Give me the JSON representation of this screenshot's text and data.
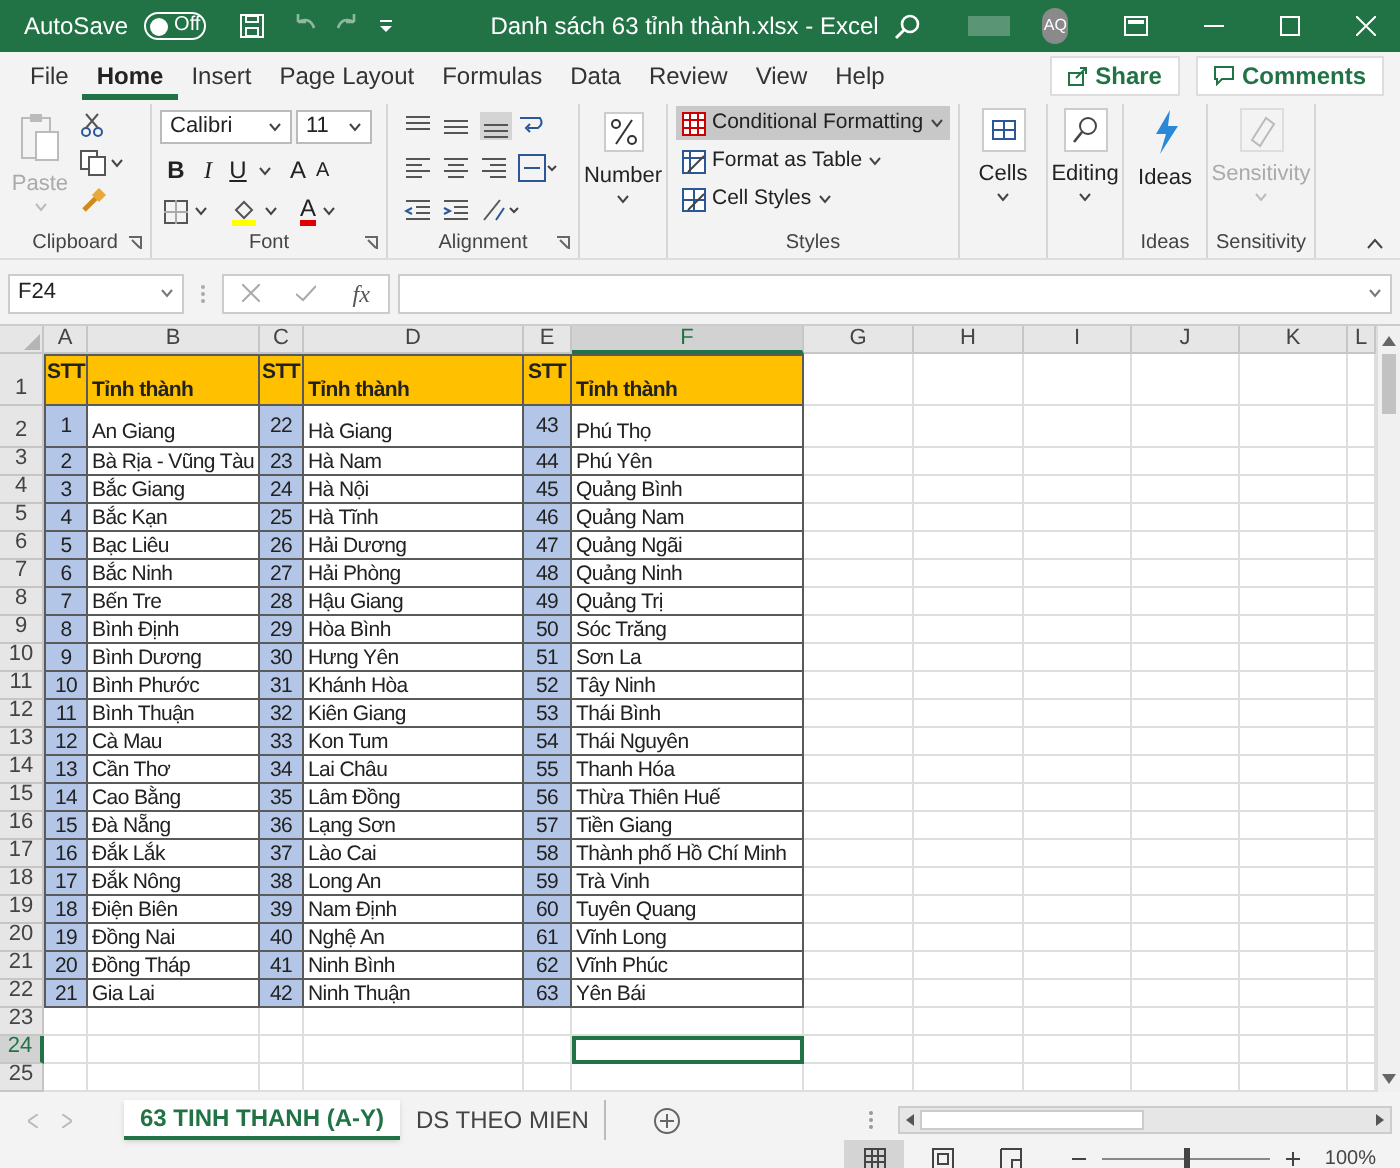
{
  "title_bar": {
    "autosave_label": "AutoSave",
    "autosave": {
      "on": false,
      "label": "Off"
    },
    "title": "Danh sách 63 tỉnh thành.xlsx - Excel",
    "avatar": "AQ"
  },
  "menu": {
    "tabs": [
      {
        "label": "File",
        "selected": false
      },
      {
        "label": "Home",
        "selected": true
      },
      {
        "label": "Insert",
        "selected": false
      },
      {
        "label": "Page Layout",
        "selected": false
      },
      {
        "label": "Formulas",
        "selected": false
      },
      {
        "label": "Data",
        "selected": false
      },
      {
        "label": "Review",
        "selected": false
      },
      {
        "label": "View",
        "selected": false
      },
      {
        "label": "Help",
        "selected": false
      }
    ],
    "share": "Share",
    "comments": "Comments"
  },
  "ribbon": {
    "clipboard": {
      "paste": {
        "label": "Paste",
        "disabled": true
      },
      "label": "Clipboard"
    },
    "font": {
      "family": "Calibri",
      "size": "11",
      "bold": "B",
      "italic": "I",
      "underline": "U",
      "grow": "A",
      "shrink": "A",
      "font_color": "A",
      "label": "Font"
    },
    "alignment": {
      "label": "Alignment"
    },
    "number": {
      "button": "Number"
    },
    "styles": {
      "items": [
        {
          "label": "Conditional Formatting",
          "selected": true
        },
        {
          "label": "Format as Table",
          "selected": false
        },
        {
          "label": "Cell Styles",
          "selected": false
        }
      ],
      "label": "Styles"
    },
    "cells": {
      "button": "Cells"
    },
    "editing": {
      "button": "Editing"
    },
    "ideas": {
      "button": "Ideas",
      "label": "Ideas"
    },
    "sensitivity": {
      "button": "Sensitivity",
      "disabled": true,
      "label": "Sensitivity"
    }
  },
  "formula_bar": {
    "name_box": "F24",
    "function_label": "fx"
  },
  "sheet": {
    "columns": [
      {
        "label": "A",
        "selected": false
      },
      {
        "label": "B",
        "selected": false
      },
      {
        "label": "C",
        "selected": false
      },
      {
        "label": "D",
        "selected": false
      },
      {
        "label": "E",
        "selected": false
      },
      {
        "label": "F",
        "selected": true
      },
      {
        "label": "G",
        "selected": false
      },
      {
        "label": "H",
        "selected": false
      },
      {
        "label": "I",
        "selected": false
      },
      {
        "label": "J",
        "selected": false
      },
      {
        "label": "K",
        "selected": false
      },
      {
        "label": "L",
        "selected": false
      }
    ],
    "row_headers": [
      {
        "label": "1",
        "selected": false
      },
      {
        "label": "2",
        "selected": false
      },
      {
        "label": "3",
        "selected": false
      },
      {
        "label": "4",
        "selected": false
      },
      {
        "label": "5",
        "selected": false
      },
      {
        "label": "6",
        "selected": false
      },
      {
        "label": "7",
        "selected": false
      },
      {
        "label": "8",
        "selected": false
      },
      {
        "label": "9",
        "selected": false
      },
      {
        "label": "10",
        "selected": false
      },
      {
        "label": "11",
        "selected": false
      },
      {
        "label": "12",
        "selected": false
      },
      {
        "label": "13",
        "selected": false
      },
      {
        "label": "14",
        "selected": false
      },
      {
        "label": "15",
        "selected": false
      },
      {
        "label": "16",
        "selected": false
      },
      {
        "label": "17",
        "selected": false
      },
      {
        "label": "18",
        "selected": false
      },
      {
        "label": "19",
        "selected": false
      },
      {
        "label": "20",
        "selected": false
      },
      {
        "label": "21",
        "selected": false
      },
      {
        "label": "22",
        "selected": false
      },
      {
        "label": "23",
        "selected": false
      },
      {
        "label": "24",
        "selected": true
      },
      {
        "label": "25",
        "selected": false
      }
    ],
    "header": [
      "STT",
      "Tỉnh thành",
      "STT",
      "Tỉnh thành",
      "STT",
      "Tỉnh thành"
    ],
    "rows": [
      [
        "1",
        "An Giang",
        "22",
        "Hà Giang",
        "43",
        "Phú Thọ"
      ],
      [
        "2",
        "Bà Rịa - Vũng Tàu",
        "23",
        "Hà Nam",
        "44",
        "Phú Yên"
      ],
      [
        "3",
        "Bắc Giang",
        "24",
        "Hà Nội",
        "45",
        "Quảng Bình"
      ],
      [
        "4",
        "Bắc Kạn",
        "25",
        "Hà Tĩnh",
        "46",
        "Quảng Nam"
      ],
      [
        "5",
        "Bạc Liêu",
        "26",
        "Hải Dương",
        "47",
        "Quảng Ngãi"
      ],
      [
        "6",
        "Bắc Ninh",
        "27",
        "Hải Phòng",
        "48",
        "Quảng Ninh"
      ],
      [
        "7",
        "Bến Tre",
        "28",
        "Hậu Giang",
        "49",
        "Quảng Trị"
      ],
      [
        "8",
        "Bình Định",
        "29",
        "Hòa Bình",
        "50",
        "Sóc Trăng"
      ],
      [
        "9",
        "Bình Dương",
        "30",
        "Hưng Yên",
        "51",
        "Sơn La"
      ],
      [
        "10",
        "Bình Phước",
        "31",
        "Khánh Hòa",
        "52",
        "Tây Ninh"
      ],
      [
        "11",
        "Bình Thuận",
        "32",
        "Kiên Giang",
        "53",
        "Thái Bình"
      ],
      [
        "12",
        "Cà Mau",
        "33",
        "Kon Tum",
        "54",
        "Thái Nguyên"
      ],
      [
        "13",
        "Cần Thơ",
        "34",
        "Lai Châu",
        "55",
        "Thanh Hóa"
      ],
      [
        "14",
        "Cao Bằng",
        "35",
        "Lâm Đồng",
        "56",
        "Thừa Thiên Huế"
      ],
      [
        "15",
        "Đà Nẵng",
        "36",
        "Lạng Sơn",
        "57",
        "Tiền Giang"
      ],
      [
        "16",
        "Đắk Lắk",
        "37",
        "Lào Cai",
        "58",
        "Thành phố Hồ Chí Minh"
      ],
      [
        "17",
        "Đắk Nông",
        "38",
        "Long An",
        "59",
        "Trà Vinh"
      ],
      [
        "18",
        "Điện Biên",
        "39",
        "Nam Định",
        "60",
        "Tuyên Quang"
      ],
      [
        "19",
        "Đồng Nai",
        "40",
        "Nghệ An",
        "61",
        "Vĩnh Long"
      ],
      [
        "20",
        "Đồng Tháp",
        "41",
        "Ninh Bình",
        "62",
        "Vĩnh Phúc"
      ],
      [
        "21",
        "Gia Lai",
        "42",
        "Ninh Thuận",
        "63",
        "Yên Bái"
      ]
    ]
  },
  "sheet_tabs": [
    {
      "label": "63 TINH THANH (A-Y)",
      "selected": true
    },
    {
      "label": "DS THEO MIEN",
      "selected": false
    }
  ],
  "status_bar": {
    "views": [
      {
        "kind": "normal",
        "selected": true
      },
      {
        "kind": "page_layout",
        "selected": false
      },
      {
        "kind": "page_break",
        "selected": false
      }
    ],
    "zoom": {
      "level": 0.5,
      "label": "100%"
    }
  }
}
